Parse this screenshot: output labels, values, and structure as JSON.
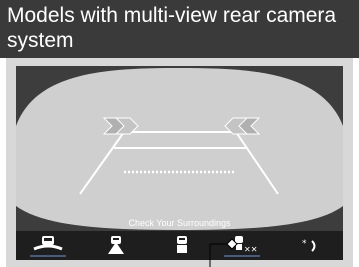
{
  "header": {
    "title": "Models with multi-view rear camera system"
  },
  "screen": {
    "message": "Check Your Surroundings",
    "colors": {
      "background": "#3d3d3d",
      "field": "#cfcfcf",
      "guide": "#ffffff",
      "chevron": "#cfcfcf",
      "bar": "#1e1e1e"
    }
  },
  "view_icons": [
    {
      "name": "top-down-view-icon"
    },
    {
      "name": "wide-view-icon"
    },
    {
      "name": "normal-view-icon"
    },
    {
      "name": "camera-settings-icon"
    },
    {
      "name": "day-night-icon"
    }
  ]
}
